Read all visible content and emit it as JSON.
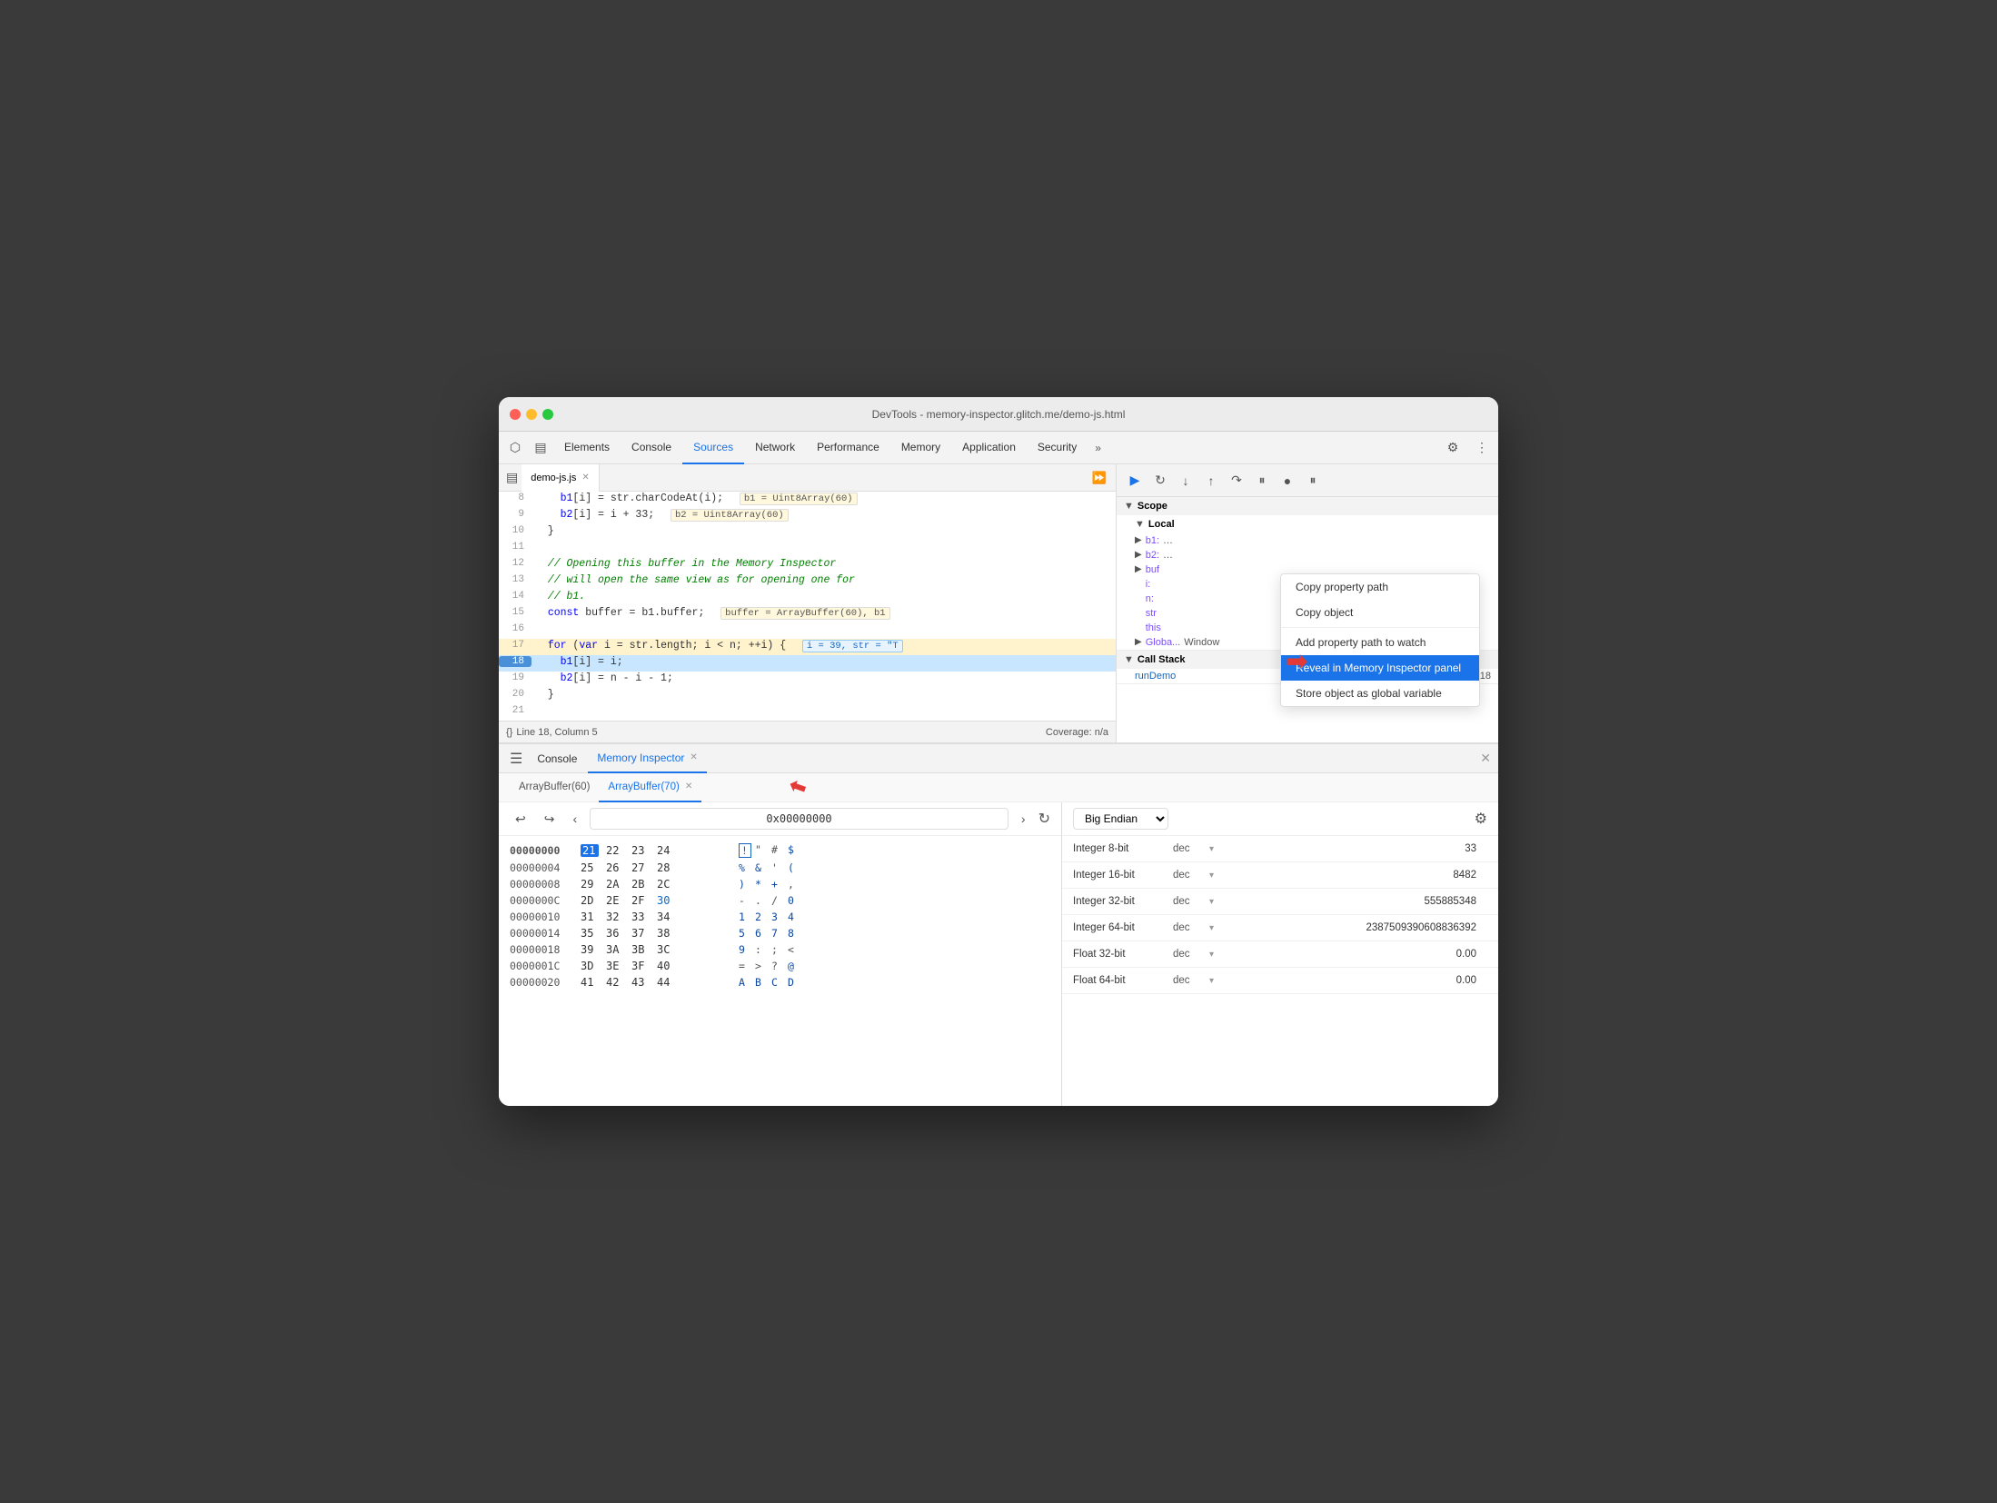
{
  "window": {
    "title": "DevTools - memory-inspector.glitch.me/demo-js.html"
  },
  "tabs": {
    "items": [
      "Elements",
      "Console",
      "Sources",
      "Network",
      "Performance",
      "Memory",
      "Application",
      "Security"
    ],
    "active": "Sources",
    "more": "»"
  },
  "editor": {
    "filename": "demo-js.js",
    "lines": [
      {
        "num": "8",
        "content": "    b1[i] = str.charCodeAt(i);",
        "inline_val": "b1 = Uint8Array(60)",
        "active": false
      },
      {
        "num": "9",
        "content": "    b2[i] = i + 33;",
        "inline_val": "b2 = Uint8Array(60)",
        "active": false
      },
      {
        "num": "10",
        "content": "  }",
        "active": false
      },
      {
        "num": "11",
        "content": "",
        "active": false
      },
      {
        "num": "12",
        "content": "  // Opening this buffer in the Memory Inspector",
        "active": false
      },
      {
        "num": "13",
        "content": "  // will open the same view as for opening one for",
        "active": false
      },
      {
        "num": "14",
        "content": "  // b1.",
        "active": false
      },
      {
        "num": "15",
        "content": "  const buffer = b1.buffer;",
        "inline_val": "buffer = ArrayBuffer(60), b1",
        "active": false
      },
      {
        "num": "16",
        "content": "",
        "active": false
      },
      {
        "num": "17",
        "content": "  for (var i = str.length; i < n; ++i) {",
        "inline_val_blue": "i = 39, str = \"T",
        "active": false
      },
      {
        "num": "18",
        "content": "    b1[i] = i;",
        "active": true
      },
      {
        "num": "19",
        "content": "    b2[i] = n - i - 1;",
        "active": false
      },
      {
        "num": "20",
        "content": "  }",
        "active": false
      },
      {
        "num": "21",
        "content": "",
        "active": false
      }
    ],
    "status": {
      "line_col": "Line 18, Column 5",
      "coverage": "Coverage: n/a"
    }
  },
  "debugger": {
    "buttons": [
      "▶",
      "⏸",
      "↷",
      "↑",
      "⤸",
      "⬇",
      "⏺",
      "⏸"
    ],
    "scope_header": "Scope",
    "local_header": "Local",
    "scope_items": [
      {
        "key": "b1:",
        "val": "…"
      },
      {
        "key": "b2:",
        "val": "…"
      },
      {
        "key": "buf",
        "val": ""
      },
      {
        "key": "i:",
        "val": ""
      },
      {
        "key": "n:",
        "val": ""
      },
      {
        "key": "str",
        "val": ""
      }
    ],
    "this_label": "this",
    "global_header": "Global",
    "global_val": "Window",
    "callstack_header": "Call Stack",
    "callstack_item": "runDemo",
    "callstack_location": "demo-js.js:18"
  },
  "context_menu": {
    "items": [
      {
        "label": "Copy property path",
        "id": "copy-prop"
      },
      {
        "label": "Copy object",
        "id": "copy-obj"
      },
      {
        "label": "sep1",
        "type": "sep"
      },
      {
        "label": "Add property path to watch",
        "id": "add-watch"
      },
      {
        "label": "Reveal in Memory Inspector panel",
        "id": "reveal-mem",
        "active": true
      },
      {
        "label": "Store object as global variable",
        "id": "store-global"
      }
    ]
  },
  "bottom_panel": {
    "tabs": [
      {
        "label": "Console",
        "active": false,
        "closeable": false
      },
      {
        "label": "Memory Inspector",
        "active": true,
        "closeable": true
      }
    ],
    "buffer_tabs": [
      {
        "label": "ArrayBuffer(60)",
        "active": false,
        "closeable": false
      },
      {
        "label": "ArrayBuffer(70)",
        "active": true,
        "closeable": true
      }
    ],
    "nav": {
      "address": "0x00000000"
    },
    "hex_rows": [
      {
        "addr": "00000000",
        "bytes": [
          "21",
          "22",
          "23",
          "24"
        ],
        "chars": [
          "!",
          "\"",
          "#",
          "$"
        ],
        "selected_idx": 0
      },
      {
        "addr": "00000004",
        "bytes": [
          "25",
          "26",
          "27",
          "28"
        ],
        "chars": [
          "%",
          "&",
          "'",
          "("
        ]
      },
      {
        "addr": "00000008",
        "bytes": [
          "29",
          "2A",
          "2B",
          "2C"
        ],
        "chars": [
          ")",
          "*",
          "+",
          ","
        ]
      },
      {
        "addr": "0000000C",
        "bytes": [
          "2D",
          "2E",
          "2F",
          "30"
        ],
        "chars": [
          "-",
          ".",
          "/",
          "0"
        ]
      },
      {
        "addr": "00000010",
        "bytes": [
          "31",
          "32",
          "33",
          "34"
        ],
        "chars": [
          "1",
          "2",
          "3",
          "4"
        ]
      },
      {
        "addr": "00000014",
        "bytes": [
          "35",
          "36",
          "37",
          "38"
        ],
        "chars": [
          "5",
          "6",
          "7",
          "8"
        ]
      },
      {
        "addr": "00000018",
        "bytes": [
          "39",
          "3A",
          "3B",
          "3C"
        ],
        "chars": [
          "9",
          ":",
          ";",
          "<"
        ]
      },
      {
        "addr": "0000001C",
        "bytes": [
          "3D",
          "3E",
          "3F",
          "40"
        ],
        "chars": [
          "=",
          ">",
          "?",
          "@"
        ]
      },
      {
        "addr": "00000020",
        "bytes": [
          "41",
          "42",
          "43",
          "44"
        ],
        "chars": [
          "A",
          "B",
          "C",
          "D"
        ]
      }
    ],
    "data_inspector": {
      "endian": "Big Endian",
      "rows": [
        {
          "label": "Integer 8-bit",
          "format": "dec",
          "value": "33"
        },
        {
          "label": "Integer 16-bit",
          "format": "dec",
          "value": "8482"
        },
        {
          "label": "Integer 32-bit",
          "format": "dec",
          "value": "555885348"
        },
        {
          "label": "Integer 64-bit",
          "format": "dec",
          "value": "2387509390608836392"
        },
        {
          "label": "Float 32-bit",
          "format": "dec",
          "value": "0.00"
        },
        {
          "label": "Float 64-bit",
          "format": "dec",
          "value": "0.00"
        }
      ]
    }
  }
}
